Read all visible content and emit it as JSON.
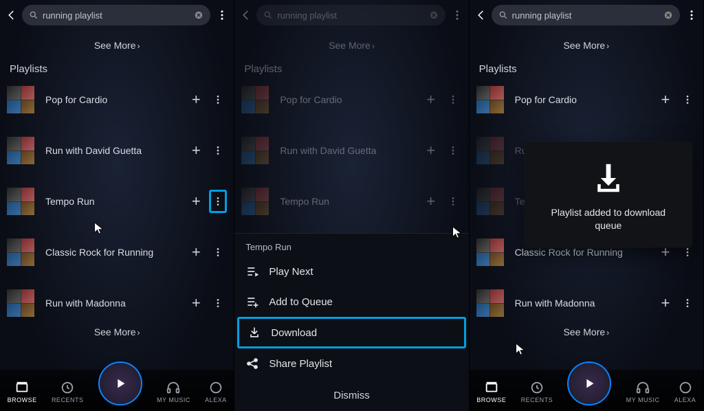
{
  "search": {
    "query": "running playlist"
  },
  "see_more": "See More",
  "section_title": "Playlists",
  "playlists": [
    {
      "title": "Pop for Cardio"
    },
    {
      "title": "Run with David Guetta"
    },
    {
      "title": "Tempo Run"
    },
    {
      "title": "Classic Rock for Running"
    },
    {
      "title": "Run with Madonna"
    }
  ],
  "context_menu": {
    "title": "Tempo Run",
    "items": [
      {
        "label": "Play Next"
      },
      {
        "label": "Add to Queue"
      },
      {
        "label": "Download"
      },
      {
        "label": "Share Playlist"
      }
    ],
    "dismiss": "Dismiss"
  },
  "toast": {
    "message": "Playlist added to download queue"
  },
  "nav": [
    {
      "label": "BROWSE"
    },
    {
      "label": "RECENTS"
    },
    {
      "label": "MY MUSIC"
    },
    {
      "label": "ALEXA"
    }
  ]
}
